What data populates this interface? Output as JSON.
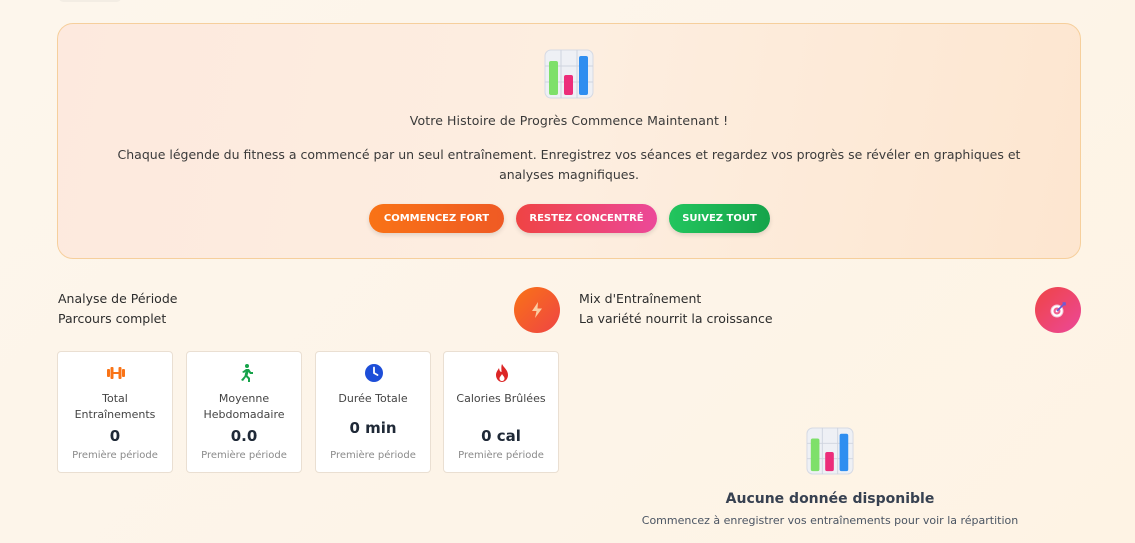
{
  "hero": {
    "icon": "bar-chart-icon",
    "title": "Votre Histoire de Progrès Commence Maintenant !",
    "text": "Chaque légende du fitness a commencé par un seul entraînement. Enregistrez vos séances et regardez vos progrès se révéler en graphiques et analyses magnifiques.",
    "buttons": [
      {
        "label": "COMMENCEZ FORT",
        "color": "#f97316"
      },
      {
        "label": "RESTEZ CONCENTRÉ",
        "color": "#ec4899"
      },
      {
        "label": "SUIVEZ TOUT",
        "color": "#22c55e"
      }
    ]
  },
  "period_analysis": {
    "title": "Analyse de Période",
    "subtitle": "Parcours complet",
    "icon": "lightning-icon"
  },
  "training_mix": {
    "title": "Mix d'Entraînement",
    "subtitle": "La variété nourrit la croissance",
    "icon": "target-icon"
  },
  "stats": [
    {
      "icon": "dumbbell-icon",
      "label": "Total Entraînements",
      "value": "0",
      "sub": "Première période",
      "color": "#f97316"
    },
    {
      "icon": "running-icon",
      "label": "Moyenne Hebdomadaire",
      "value": "0.0",
      "sub": "Première période",
      "color": "#16a34a"
    },
    {
      "icon": "clock-icon",
      "label": "Durée Totale",
      "value": "0 min",
      "sub": "Première période",
      "color": "#2563eb"
    },
    {
      "icon": "flame-icon",
      "label": "Calories Brûlées",
      "value": "0 cal",
      "sub": "Première période",
      "color": "#dc2626"
    }
  ],
  "empty_state": {
    "icon": "bar-chart-icon",
    "title": "Aucune donnée disponible",
    "subtitle": "Commencez à enregistrer vos entraînements pour voir la répartition"
  }
}
